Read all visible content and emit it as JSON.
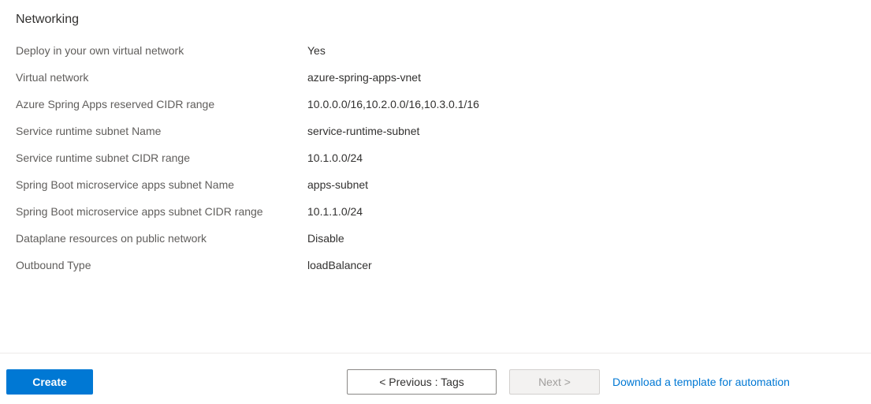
{
  "section": {
    "title": "Networking"
  },
  "fields": {
    "deployVnet": {
      "label": "Deploy in your own virtual network",
      "value": "Yes"
    },
    "virtualNetwork": {
      "label": "Virtual network",
      "value": "azure-spring-apps-vnet"
    },
    "cidrRange": {
      "label": "Azure Spring Apps reserved CIDR range",
      "value": "10.0.0.0/16,10.2.0.0/16,10.3.0.1/16"
    },
    "runtimeSubnetName": {
      "label": "Service runtime subnet Name",
      "value": "service-runtime-subnet"
    },
    "runtimeSubnetCidr": {
      "label": "Service runtime subnet CIDR range",
      "value": "10.1.0.0/24"
    },
    "appsSubnetName": {
      "label": "Spring Boot microservice apps subnet Name",
      "value": "apps-subnet"
    },
    "appsSubnetCidr": {
      "label": "Spring Boot microservice apps subnet CIDR range",
      "value": "10.1.1.0/24"
    },
    "dataplane": {
      "label": "Dataplane resources on public network",
      "value": "Disable"
    },
    "outboundType": {
      "label": "Outbound Type",
      "value": "loadBalancer"
    }
  },
  "footer": {
    "create": "Create",
    "previous": "< Previous : Tags",
    "next": "Next >",
    "download": "Download a template for automation"
  }
}
